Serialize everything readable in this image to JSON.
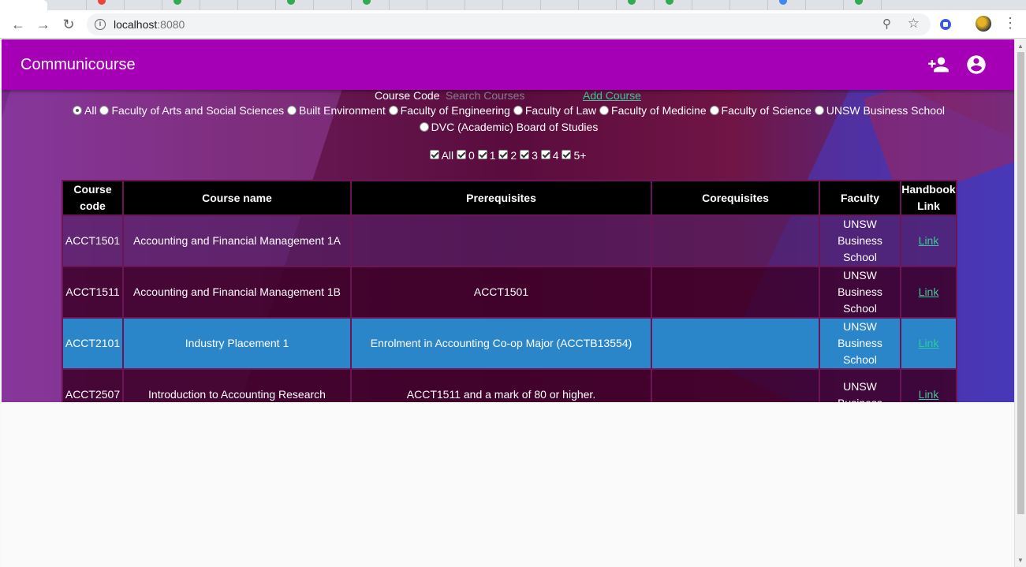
{
  "browser": {
    "url_host": "localhost",
    "url_port": ":8080"
  },
  "app": {
    "title": "Communicourse"
  },
  "search": {
    "label": "Course Code",
    "placeholder": "Search Courses",
    "add_course_label": "Add Course"
  },
  "faculties": {
    "selected": "All",
    "options": [
      "All",
      "Faculty of Arts and Social Sciences",
      "Built Environment",
      "Faculty of Engineering",
      "Faculty of Law",
      "Faculty of Medicine",
      "Faculty of Science",
      "UNSW Business School",
      "DVC (Academic) Board of Studies"
    ]
  },
  "levels": {
    "options": [
      "All",
      "0",
      "1",
      "2",
      "3",
      "4",
      "5+"
    ],
    "all_checked": true
  },
  "table": {
    "headers": [
      "Course code",
      "Course name",
      "Prerequisites",
      "Corequisites",
      "Faculty",
      "Handbook Link"
    ],
    "rows": [
      {
        "code": "ACCT1501",
        "name": "Accounting and Financial Management 1A",
        "prereq": "",
        "coreq": "",
        "faculty": "UNSW Business School",
        "link": "Link"
      },
      {
        "code": "ACCT1511",
        "name": "Accounting and Financial Management 1B",
        "prereq": "ACCT1501",
        "coreq": "",
        "faculty": "UNSW Business School",
        "link": "Link"
      },
      {
        "code": "ACCT2101",
        "name": "Industry Placement 1",
        "prereq": "Enrolment in Accounting Co-op Major (ACCTB13554)",
        "coreq": "",
        "faculty": "UNSW Business School",
        "link": "Link"
      },
      {
        "code": "ACCT2507",
        "name": "Introduction to Accounting Research",
        "prereq": "ACCT1511 and a mark of 80 or higher.",
        "coreq": "",
        "faculty": "UNSW Business",
        "link": "Link"
      }
    ],
    "highlighted_row": 2
  },
  "colors": {
    "appbar": "#a600b6",
    "link": "#3ec795",
    "highlight_row": "#2b86c9"
  },
  "icons": [
    "back-icon",
    "forward-icon",
    "reload-icon",
    "info-icon",
    "key-icon",
    "star-icon",
    "extension-icon",
    "profile-icon",
    "kebab-menu-icon",
    "add-user-icon",
    "account-icon"
  ]
}
